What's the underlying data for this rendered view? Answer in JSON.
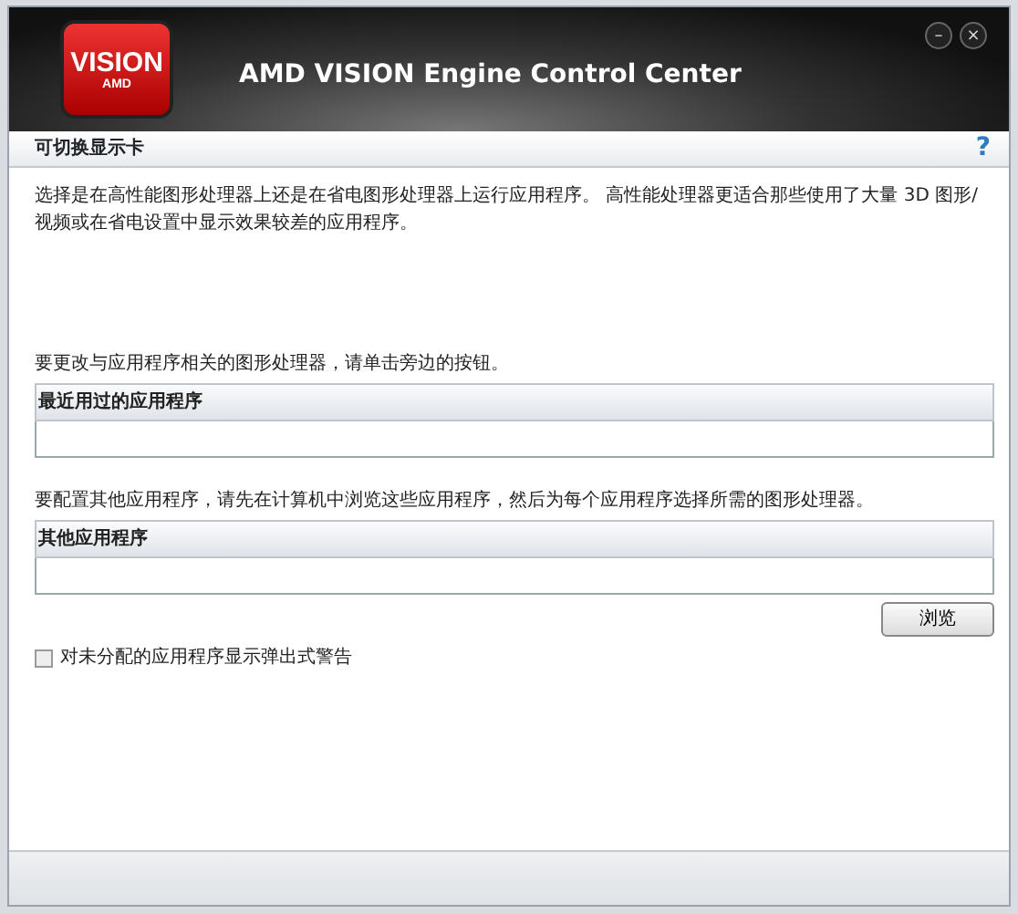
{
  "window": {
    "logo_text": "VISION",
    "logo_subtext": "AMD",
    "title": "AMD VISION Engine Control Center",
    "minimize": "–",
    "close": "×"
  },
  "page": {
    "title": "可切换显示卡",
    "help": "?"
  },
  "intro": "选择是在高性能图形处理器上还是在省电图形处理器上运行应用程序。 高性能处理器更适合那些使用了大量 3D 图形/视频或在省电设置中显示效果较差的应用程序。",
  "recent": {
    "hint": "要更改与应用程序相关的图形处理器，请单击旁边的按钮。",
    "header": "最近用过的应用程序"
  },
  "other": {
    "hint": "要配置其他应用程序，请先在计算机中浏览这些应用程序，然后为每个应用程序选择所需的图形处理器。",
    "header": "其他应用程序",
    "browse": "浏览"
  },
  "warning": {
    "label": "对未分配的应用程序显示弹出式警告",
    "checked": false
  }
}
